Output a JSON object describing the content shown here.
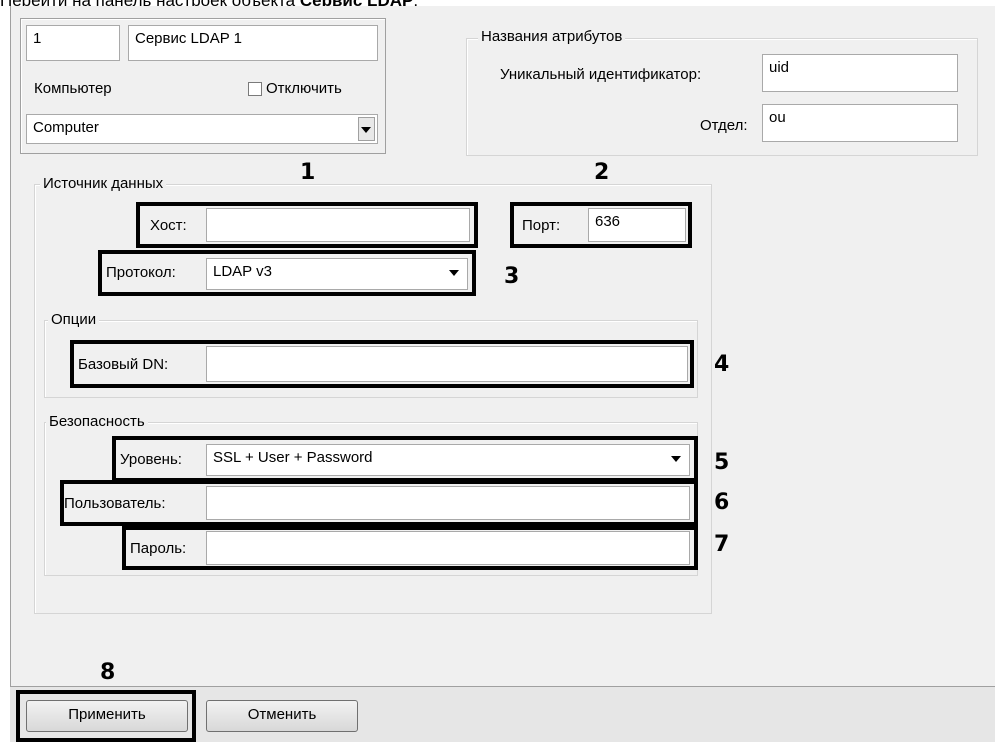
{
  "caption": {
    "prefix": "Перейти на панель настроек объекта ",
    "object": "Сервис LDAP",
    "suffix": "."
  },
  "header": {
    "id_value": "1",
    "name_value": "Сервис LDAP 1",
    "computer_label": "Компьютер",
    "disable_label": "Отключить",
    "computer_value": "Computer"
  },
  "attributes": {
    "legend": "Названия атрибутов",
    "uid_label": "Уникальный идентификатор:",
    "uid_value": "uid",
    "dept_label": "Отдел:",
    "dept_value": "ou"
  },
  "source": {
    "legend": "Источник данных",
    "host_label": "Хост:",
    "host_value": "",
    "port_label": "Порт:",
    "port_value": "636",
    "protocol_label": "Протокол:",
    "protocol_value": "LDAP v3"
  },
  "options": {
    "legend": "Опции",
    "basedn_label": "Базовый DN:",
    "basedn_value": ""
  },
  "security": {
    "legend": "Безопасность",
    "level_label": "Уровень:",
    "level_value": "SSL + User + Password",
    "user_label": "Пользователь:",
    "user_value": "",
    "password_label": "Пароль:",
    "password_value": ""
  },
  "callouts": [
    "1",
    "2",
    "3",
    "4",
    "5",
    "6",
    "7",
    "8"
  ],
  "buttons": {
    "apply": "Применить",
    "cancel": "Отменить"
  },
  "icons": {
    "checkbox": "checkbox-icon",
    "dropdown": "chevron-down-icon"
  },
  "colors": {
    "panel": "#f0f0f0",
    "highlight": "#000000"
  }
}
